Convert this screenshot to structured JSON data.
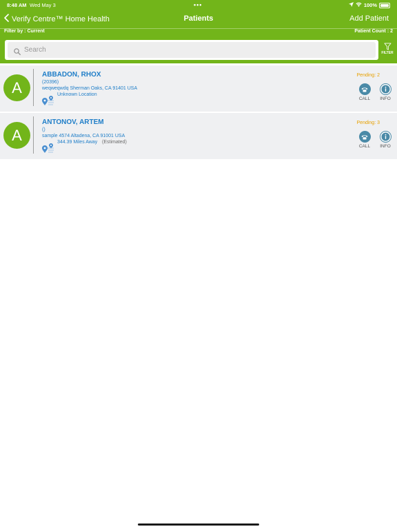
{
  "status_bar": {
    "time": "8:48 AM",
    "date": "Wed May 3",
    "battery": "100%"
  },
  "nav": {
    "back_label": "Verify Centre™ Home Health",
    "title": "Patients",
    "add_patient": "Add Patient"
  },
  "filter_bar": {
    "filter_by": "Filter by : Current",
    "patient_count": "Patient Count : 2"
  },
  "search": {
    "placeholder": "Search"
  },
  "filter_button": {
    "label": "FILTER"
  },
  "patients": [
    {
      "initial": "A",
      "name": "ABBADON, RHOX",
      "id": "(20396)",
      "address": "weqweqwdq Sherman Oaks, CA 91401 USA",
      "location": "Unknown Location",
      "estimate": "",
      "pending": "Pending: 2",
      "call_label": "CALL",
      "info_label": "INFO"
    },
    {
      "initial": "A",
      "name": "ANTONOV, ARTEM",
      "id": "()",
      "address": "sample 4574 Altadena, CA 91001 USA",
      "location": "344.39 Miles Away",
      "estimate": "(Estimated)",
      "pending": "Pending: 3",
      "call_label": "CALL",
      "info_label": "INFO"
    }
  ],
  "colors": {
    "header_green": "#72b51a",
    "link_blue": "#1f7ec8",
    "pending_orange": "#e6a000",
    "row_bg": "#eff0f2"
  }
}
